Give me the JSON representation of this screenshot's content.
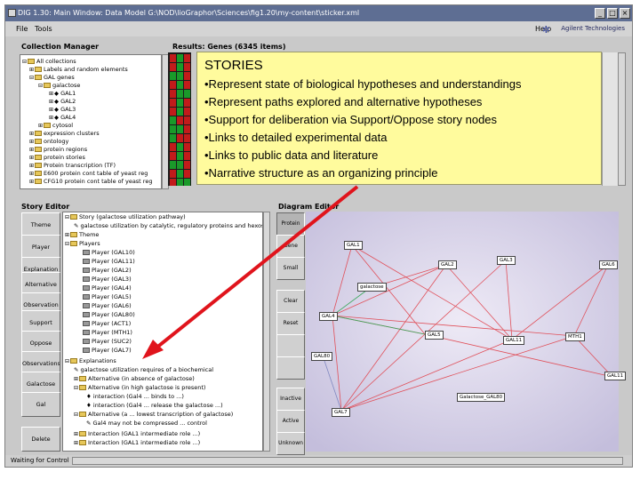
{
  "window": {
    "title": "DIG 1.30: Main Window: Data Model G:\\NOD\\lioGraphor\\Sciences\\fig1.20\\my-content\\sticker.xml",
    "buttons": [
      "_",
      "□",
      "×"
    ]
  },
  "menubar": {
    "file": "File",
    "tools": "Tools",
    "help": "Help",
    "brand": "Agilent Technologies"
  },
  "collection_manager": {
    "title": "Collection Manager",
    "items": [
      "All collections",
      "Labels and random elements",
      "GAL genes",
      "galactose",
      "GAL1",
      "GAL2",
      "GAL3",
      "GAL4",
      "cytosol",
      "expression clusters",
      "ontology",
      "protein regions",
      "protein stories",
      "Protein transcription (TF)",
      "E600 protein cont table of yeast reg",
      "CFG10 protein cont table of yeast reg"
    ]
  },
  "results": {
    "title": "Results: Genes (6345 items)"
  },
  "story_editor": {
    "title": "Story Editor",
    "buttons": [
      "Theme",
      "Player",
      "Explanation",
      "Alternative",
      "Observation",
      "Support",
      "Oppose",
      "Observations",
      "Galactose",
      "Gal",
      "Delete"
    ],
    "tree": [
      "Story (galactose utilization pathway)",
      "galactose utilization by catalytic, regulatory proteins and hexoses",
      "Theme",
      "Players",
      "Player (GAL10)",
      "Player (GAL11)",
      "Player (GAL2)",
      "Player (GAL3)",
      "Player (GAL4)",
      "Player (GAL5)",
      "Player (GAL6)",
      "Player (GAL80)",
      "Player (ACT1)",
      "Player (MTH1)",
      "Player (SUC2)",
      "Player (GAL7)",
      "Explanations",
      "galactose utilization requires of a biochemical",
      "Alternative (in absence of galactose)",
      "Alternative (in high galactose is present)",
      "interaction (Gal4 ... binds to ...)",
      "interaction (Gal4 ... release the galactose ...)",
      "Alternative (a ... lowest transcription of galactose)",
      "Gal4 may not be compressed ... control",
      "Interaction (GAL1 intermediate role ...)",
      "Interaction (GAL1 intermediate role ...)"
    ]
  },
  "diagram_editor": {
    "title": "Diagram Editor",
    "buttons": [
      "Protein",
      "Gene",
      "Small",
      "Clear",
      "Reset",
      "",
      "",
      "Inactive",
      "Active",
      "Unknown"
    ],
    "nodes": [
      "GAL1",
      "GAL2",
      "GAL3",
      "GAL4",
      "GAL5",
      "GAL6",
      "GAL7",
      "GAL11",
      "MTH1",
      "Gal4",
      "galactose",
      "GAL80",
      "Galactose_GAL80",
      "GAL11",
      "SUC2"
    ]
  },
  "stories_overlay": {
    "title": "STORIES",
    "items": [
      "•Represent state of biological hypotheses and understandings",
      "•Represent paths explored and alternative hypotheses",
      "•Support for deliberation via Support/Oppose story nodes",
      "•Links to detailed experimental data",
      "•Links to public data and literature",
      "•Narrative structure as an organizing principle"
    ]
  },
  "statusbar": {
    "text": "Waiting for Control"
  },
  "colors": {
    "titlebar": "#5e6e93",
    "overlay": "#fffb9d",
    "arrow": "#e0141c",
    "edge_red": "#e0505a",
    "edge_green": "#3aa85a",
    "heatmap_red": "#c21b1b",
    "heatmap_green": "#1a9a2a"
  }
}
